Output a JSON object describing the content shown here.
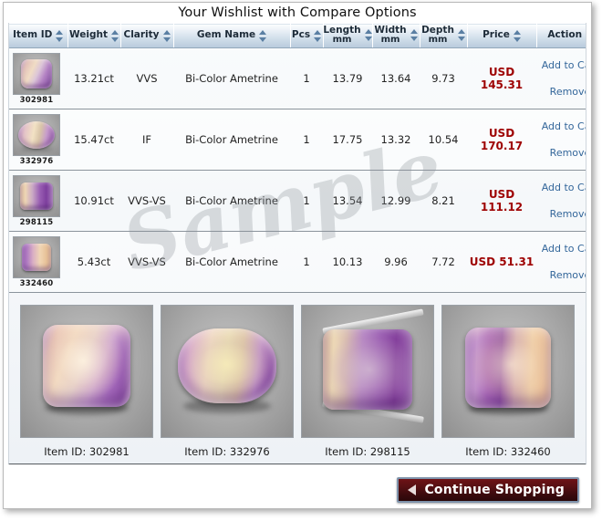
{
  "page": {
    "title": "Your Wishlist with Compare Options",
    "watermark": "Sample"
  },
  "table": {
    "columns": [
      {
        "label": "Item ID",
        "unit": "",
        "sortable": true
      },
      {
        "label": "Weight",
        "unit": "",
        "sortable": true
      },
      {
        "label": "Clarity",
        "unit": "",
        "sortable": true
      },
      {
        "label": "Gem Name",
        "unit": "",
        "sortable": true
      },
      {
        "label": "Pcs",
        "unit": "",
        "sortable": true
      },
      {
        "label": "Length",
        "unit": "mm",
        "sortable": true
      },
      {
        "label": "Width",
        "unit": "mm",
        "sortable": true
      },
      {
        "label": "Depth",
        "unit": "mm",
        "sortable": true
      },
      {
        "label": "Price",
        "unit": "",
        "sortable": true
      },
      {
        "label": "Action",
        "unit": "",
        "sortable": true
      }
    ],
    "rows": [
      {
        "item_id": "302981",
        "weight": "13.21ct",
        "clarity": "VVS",
        "gem_name": "Bi-Color Ametrine",
        "pcs": "1",
        "length": "13.79",
        "width": "13.64",
        "depth": "9.73",
        "price": "USD 145.31",
        "add_label": "Add to Cart",
        "remove_label": "Remove"
      },
      {
        "item_id": "332976",
        "weight": "15.47ct",
        "clarity": "IF",
        "gem_name": "Bi-Color Ametrine",
        "pcs": "1",
        "length": "17.75",
        "width": "13.32",
        "depth": "10.54",
        "price": "USD 170.17",
        "add_label": "Add to Cart",
        "remove_label": "Remove"
      },
      {
        "item_id": "298115",
        "weight": "10.91ct",
        "clarity": "VVS-VS",
        "gem_name": "Bi-Color Ametrine",
        "pcs": "1",
        "length": "13.54",
        "width": "12.99",
        "depth": "8.21",
        "price": "USD 111.12",
        "add_label": "Add to Cart",
        "remove_label": "Remove"
      },
      {
        "item_id": "332460",
        "weight": "5.43ct",
        "clarity": "VVS-VS",
        "gem_name": "Bi-Color Ametrine",
        "pcs": "1",
        "length": "10.13",
        "width": "9.96",
        "depth": "7.72",
        "price": "USD 51.31",
        "add_label": "Add to Cart",
        "remove_label": "Remove"
      }
    ]
  },
  "gallery": {
    "items": [
      {
        "caption": "Item ID: 302981"
      },
      {
        "caption": "Item ID: 332976"
      },
      {
        "caption": "Item ID: 298115"
      },
      {
        "caption": "Item ID: 332460"
      }
    ]
  },
  "footer": {
    "continue_label": "Continue Shopping",
    "arrow_icon": "triangle-left-icon"
  },
  "colors": {
    "price": "#9e0202",
    "link": "#33669a",
    "header_gradient_top": "#fdfefe",
    "header_gradient_bottom": "#b9cbdc",
    "button_dark_red": "#571013",
    "button_border": "#7f93ab"
  }
}
